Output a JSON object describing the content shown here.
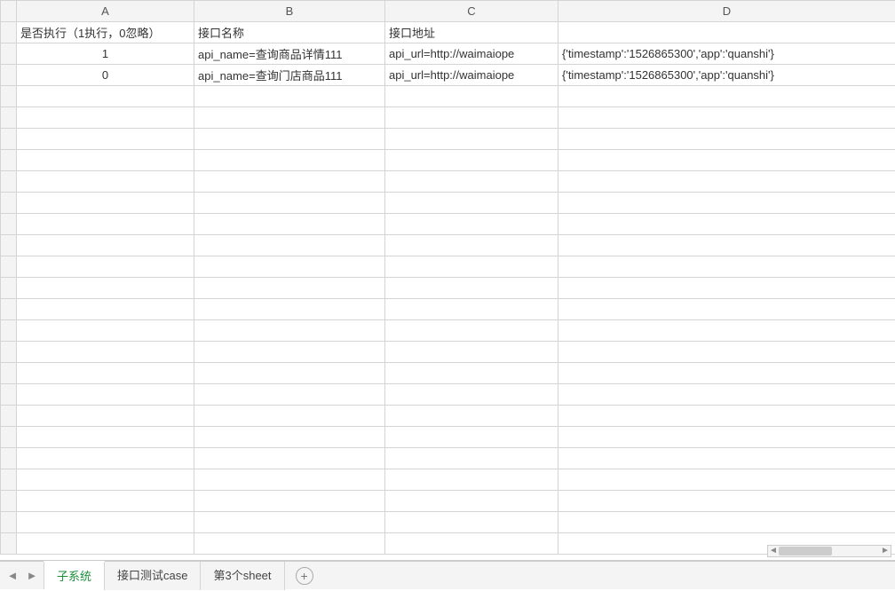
{
  "columns": [
    "A",
    "B",
    "C",
    "D"
  ],
  "headers": {
    "A": "是否执行（1执行，0忽略）",
    "B": "接口名称",
    "C": "接口地址",
    "D": ""
  },
  "rows": [
    {
      "A": "1",
      "B": "api_name=查询商品详情111",
      "C": "api_url=http://waimaiope",
      "D": "{'timestamp':'1526865300','app':'quanshi'}"
    },
    {
      "A": "0",
      "B": "api_name=查询门店商品111",
      "C": "api_url=http://waimaiope",
      "D": "{'timestamp':'1526865300','app':'quanshi'}"
    }
  ],
  "totalRows": 25,
  "tabs": [
    {
      "label": "子系统",
      "active": true
    },
    {
      "label": "接口测试case",
      "active": false
    },
    {
      "label": "第3个sheet",
      "active": false
    }
  ]
}
